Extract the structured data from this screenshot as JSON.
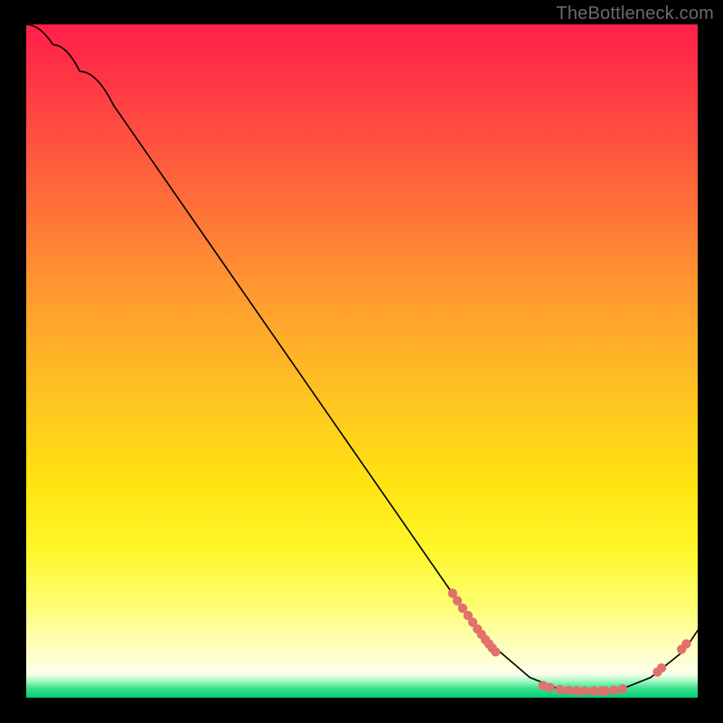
{
  "watermark": "TheBottleneck.com",
  "chart_data": {
    "type": "line",
    "title": "",
    "xlabel": "",
    "ylabel": "",
    "xlim": [
      0,
      100
    ],
    "ylim": [
      0,
      100
    ],
    "series": [
      {
        "name": "bottleneck-curve",
        "x": [
          0,
          4,
          8,
          13,
          68,
          75,
          80,
          88,
          93,
          98,
          100
        ],
        "y": [
          100,
          97,
          93,
          88,
          9,
          3,
          1,
          1,
          3,
          7,
          10
        ]
      }
    ],
    "markers": [
      {
        "name": "cluster-on-descent",
        "color": "#e2716c",
        "points": [
          {
            "x": 63.5,
            "y": 15.5
          },
          {
            "x": 64.2,
            "y": 14.4
          },
          {
            "x": 65.0,
            "y": 13.3
          },
          {
            "x": 65.8,
            "y": 12.2
          },
          {
            "x": 66.5,
            "y": 11.2
          },
          {
            "x": 67.2,
            "y": 10.2
          },
          {
            "x": 67.8,
            "y": 9.4
          },
          {
            "x": 68.4,
            "y": 8.6
          },
          {
            "x": 68.9,
            "y": 8.0
          },
          {
            "x": 69.4,
            "y": 7.4
          },
          {
            "x": 69.9,
            "y": 6.8
          }
        ]
      },
      {
        "name": "cluster-trough",
        "color": "#e2716c",
        "points": [
          {
            "x": 77.0,
            "y": 1.8
          },
          {
            "x": 78.0,
            "y": 1.5
          },
          {
            "x": 79.5,
            "y": 1.2
          },
          {
            "x": 80.8,
            "y": 1.1
          },
          {
            "x": 82.0,
            "y": 1.0
          },
          {
            "x": 83.2,
            "y": 1.0
          },
          {
            "x": 84.5,
            "y": 1.0
          },
          {
            "x": 85.7,
            "y": 1.0
          },
          {
            "x": 86.2,
            "y": 1.0
          },
          {
            "x": 87.5,
            "y": 1.1
          },
          {
            "x": 88.8,
            "y": 1.3
          }
        ]
      },
      {
        "name": "cluster-on-ascent",
        "color": "#e2716c",
        "points": [
          {
            "x": 94.0,
            "y": 3.8
          },
          {
            "x": 94.6,
            "y": 4.4
          },
          {
            "x": 97.6,
            "y": 7.2
          },
          {
            "x": 98.3,
            "y": 8.0
          }
        ]
      }
    ]
  }
}
